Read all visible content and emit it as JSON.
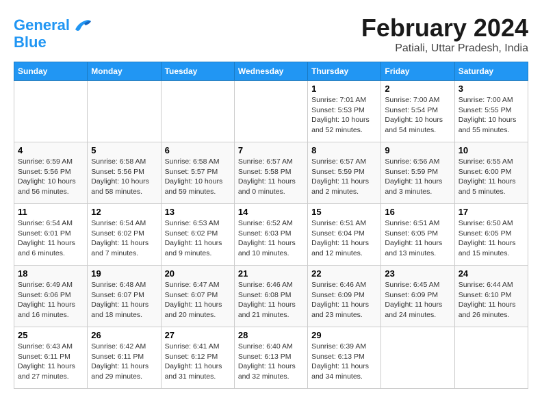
{
  "logo": {
    "line1": "General",
    "line2": "Blue"
  },
  "header": {
    "month": "February 2024",
    "location": "Patiali, Uttar Pradesh, India"
  },
  "weekdays": [
    "Sunday",
    "Monday",
    "Tuesday",
    "Wednesday",
    "Thursday",
    "Friday",
    "Saturday"
  ],
  "weeks": [
    [
      {
        "day": "",
        "info": ""
      },
      {
        "day": "",
        "info": ""
      },
      {
        "day": "",
        "info": ""
      },
      {
        "day": "",
        "info": ""
      },
      {
        "day": "1",
        "info": "Sunrise: 7:01 AM\nSunset: 5:53 PM\nDaylight: 10 hours\nand 52 minutes."
      },
      {
        "day": "2",
        "info": "Sunrise: 7:00 AM\nSunset: 5:54 PM\nDaylight: 10 hours\nand 54 minutes."
      },
      {
        "day": "3",
        "info": "Sunrise: 7:00 AM\nSunset: 5:55 PM\nDaylight: 10 hours\nand 55 minutes."
      }
    ],
    [
      {
        "day": "4",
        "info": "Sunrise: 6:59 AM\nSunset: 5:56 PM\nDaylight: 10 hours\nand 56 minutes."
      },
      {
        "day": "5",
        "info": "Sunrise: 6:58 AM\nSunset: 5:56 PM\nDaylight: 10 hours\nand 58 minutes."
      },
      {
        "day": "6",
        "info": "Sunrise: 6:58 AM\nSunset: 5:57 PM\nDaylight: 10 hours\nand 59 minutes."
      },
      {
        "day": "7",
        "info": "Sunrise: 6:57 AM\nSunset: 5:58 PM\nDaylight: 11 hours\nand 0 minutes."
      },
      {
        "day": "8",
        "info": "Sunrise: 6:57 AM\nSunset: 5:59 PM\nDaylight: 11 hours\nand 2 minutes."
      },
      {
        "day": "9",
        "info": "Sunrise: 6:56 AM\nSunset: 5:59 PM\nDaylight: 11 hours\nand 3 minutes."
      },
      {
        "day": "10",
        "info": "Sunrise: 6:55 AM\nSunset: 6:00 PM\nDaylight: 11 hours\nand 5 minutes."
      }
    ],
    [
      {
        "day": "11",
        "info": "Sunrise: 6:54 AM\nSunset: 6:01 PM\nDaylight: 11 hours\nand 6 minutes."
      },
      {
        "day": "12",
        "info": "Sunrise: 6:54 AM\nSunset: 6:02 PM\nDaylight: 11 hours\nand 7 minutes."
      },
      {
        "day": "13",
        "info": "Sunrise: 6:53 AM\nSunset: 6:02 PM\nDaylight: 11 hours\nand 9 minutes."
      },
      {
        "day": "14",
        "info": "Sunrise: 6:52 AM\nSunset: 6:03 PM\nDaylight: 11 hours\nand 10 minutes."
      },
      {
        "day": "15",
        "info": "Sunrise: 6:51 AM\nSunset: 6:04 PM\nDaylight: 11 hours\nand 12 minutes."
      },
      {
        "day": "16",
        "info": "Sunrise: 6:51 AM\nSunset: 6:05 PM\nDaylight: 11 hours\nand 13 minutes."
      },
      {
        "day": "17",
        "info": "Sunrise: 6:50 AM\nSunset: 6:05 PM\nDaylight: 11 hours\nand 15 minutes."
      }
    ],
    [
      {
        "day": "18",
        "info": "Sunrise: 6:49 AM\nSunset: 6:06 PM\nDaylight: 11 hours\nand 16 minutes."
      },
      {
        "day": "19",
        "info": "Sunrise: 6:48 AM\nSunset: 6:07 PM\nDaylight: 11 hours\nand 18 minutes."
      },
      {
        "day": "20",
        "info": "Sunrise: 6:47 AM\nSunset: 6:07 PM\nDaylight: 11 hours\nand 20 minutes."
      },
      {
        "day": "21",
        "info": "Sunrise: 6:46 AM\nSunset: 6:08 PM\nDaylight: 11 hours\nand 21 minutes."
      },
      {
        "day": "22",
        "info": "Sunrise: 6:46 AM\nSunset: 6:09 PM\nDaylight: 11 hours\nand 23 minutes."
      },
      {
        "day": "23",
        "info": "Sunrise: 6:45 AM\nSunset: 6:09 PM\nDaylight: 11 hours\nand 24 minutes."
      },
      {
        "day": "24",
        "info": "Sunrise: 6:44 AM\nSunset: 6:10 PM\nDaylight: 11 hours\nand 26 minutes."
      }
    ],
    [
      {
        "day": "25",
        "info": "Sunrise: 6:43 AM\nSunset: 6:11 PM\nDaylight: 11 hours\nand 27 minutes."
      },
      {
        "day": "26",
        "info": "Sunrise: 6:42 AM\nSunset: 6:11 PM\nDaylight: 11 hours\nand 29 minutes."
      },
      {
        "day": "27",
        "info": "Sunrise: 6:41 AM\nSunset: 6:12 PM\nDaylight: 11 hours\nand 31 minutes."
      },
      {
        "day": "28",
        "info": "Sunrise: 6:40 AM\nSunset: 6:13 PM\nDaylight: 11 hours\nand 32 minutes."
      },
      {
        "day": "29",
        "info": "Sunrise: 6:39 AM\nSunset: 6:13 PM\nDaylight: 11 hours\nand 34 minutes."
      },
      {
        "day": "",
        "info": ""
      },
      {
        "day": "",
        "info": ""
      }
    ]
  ]
}
